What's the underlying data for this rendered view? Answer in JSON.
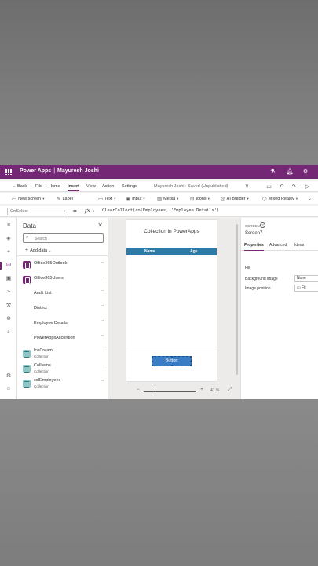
{
  "app": {
    "name": "Power Apps",
    "author": "Mayuresh Joshi",
    "status": "Mayuresh Joshi : Saved (Unpublished)"
  },
  "menu": {
    "back": "Back",
    "items": [
      "File",
      "Home",
      "Insert",
      "View",
      "Action",
      "Settings"
    ],
    "active": "Insert"
  },
  "toolbar": {
    "new_screen": "New screen",
    "label": "Label",
    "text": "Text",
    "input": "Input",
    "media": "Media",
    "icons": "Icons",
    "ai_builder": "AI Builder",
    "mixed_reality": "Mixed Reality"
  },
  "formula_bar": {
    "property": "OnSelect",
    "equals": "=",
    "fx": "fx",
    "formula": "ClearCollect(colEmployees, 'Employee Details')"
  },
  "data_panel": {
    "title": "Data",
    "search_placeholder": "Search",
    "add_data": "Add data",
    "sources": [
      {
        "name": "Office365Outlook",
        "kind": "office"
      },
      {
        "name": "Office365Users",
        "kind": "office"
      },
      {
        "name": "Audit List",
        "kind": "list"
      },
      {
        "name": "District",
        "kind": "list"
      },
      {
        "name": "Employee Details",
        "kind": "list"
      },
      {
        "name": "PowerAppsAccordion",
        "kind": "list"
      },
      {
        "name": "IceCream",
        "sub": "Collection",
        "kind": "collection"
      },
      {
        "name": "ColItems",
        "sub": "Collection",
        "kind": "collection"
      },
      {
        "name": "colEmployees",
        "sub": "Collection",
        "kind": "collection"
      }
    ]
  },
  "canvas": {
    "screen_title": "Collection in PowerApps",
    "gallery_columns": [
      "Name",
      "Age"
    ],
    "button_label": "Button",
    "zoom": "41 %",
    "zoom_level": 0.41
  },
  "properties": {
    "kind": "SCREEN",
    "name": "Screen7",
    "tabs": [
      "Properties",
      "Advanced",
      "Ideas"
    ],
    "active_tab": "Properties",
    "fill": "Fill",
    "background_image": "Background image",
    "background_image_value": "None",
    "image_position": "Image position",
    "image_position_value": "Fit"
  },
  "colors": {
    "brand": "#742774",
    "gallery_header": "#2b7aa8",
    "button": "#3a7dc4"
  }
}
